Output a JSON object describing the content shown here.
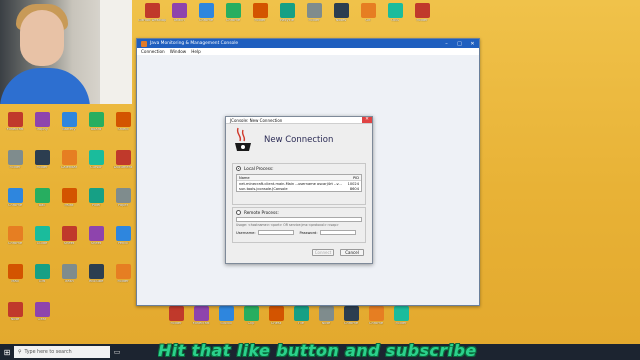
{
  "main_window": {
    "title": "Java Monitoring & Management Console",
    "menu": [
      "Connection",
      "Window",
      "Help"
    ],
    "controls": [
      "–",
      "□",
      "✕"
    ]
  },
  "dialog": {
    "title": "JConsole: New Connection",
    "heading": "New Connection",
    "local_label": "Local Process:",
    "remote_label": "Remote Process:",
    "table_headers": {
      "name": "Name",
      "pid": "PID"
    },
    "processes": [
      {
        "name": "net.minecraft.client.main.Main --username oscarj4rt --v...",
        "pid": "10024"
      },
      {
        "name": "sun.tools.jconsole.JConsole",
        "pid": "8604"
      }
    ],
    "remote_hint": "Usage: <hostname>:<port> OR service:jmx:<protocol>:<sap>",
    "username_label": "Username:",
    "password_label": "Password:",
    "connect_label": "Connect",
    "cancel_label": "Cancel"
  },
  "taskbar": {
    "search_placeholder": "Type here to search"
  },
  "banner": "Hit that like button and subscribe",
  "desktop_icons": {
    "top_row": [
      "GitHub Desktop",
      "Twitch",
      "Chrome",
      "Chrome",
      "Folder",
      "Recycle",
      "Folder",
      "Notes",
      "Git",
      "OBS",
      "Folder"
    ],
    "left_col": [
      "Minecraft",
      "Trophy",
      "Battery",
      "Board",
      "Shield",
      "Folder",
      "Folder",
      "Folder",
      "Calendar",
      "Cursor",
      "Document",
      "Music",
      "Chrome",
      "Ball",
      "Paint",
      "Pixel",
      "Paper",
      "Dragon",
      "Chrome",
      "Guide",
      "Sheet",
      "Sheet",
      "Pencil",
      "Plant",
      "Mail",
      "Gift",
      "Trash",
      "YouTube",
      "Folder",
      "Wolf",
      "Note",
      "Gear"
    ],
    "bottom_row": [
      "Folder",
      "Minecraft",
      "Studio",
      "Clip",
      "Chest",
      "File",
      "Note",
      "Chrome",
      "Chrome",
      "Folder"
    ]
  }
}
